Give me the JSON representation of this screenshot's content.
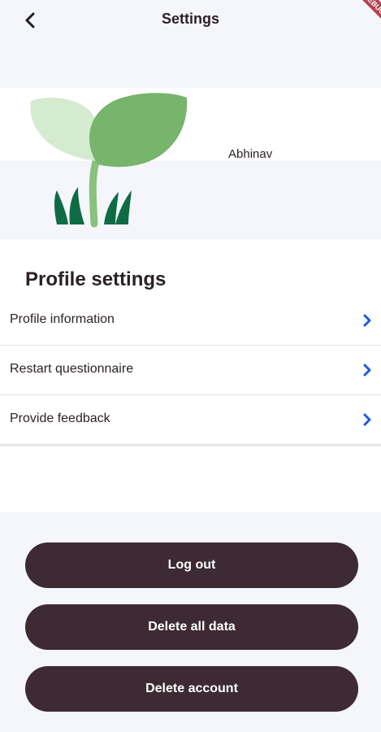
{
  "appbar": {
    "title": "Settings",
    "back_icon": "chevron-left-icon",
    "debug_banner": "DEBUG"
  },
  "profile": {
    "name": "Abhinav",
    "avatar_icon": "sprout-icon"
  },
  "settings": {
    "title": "Profile settings",
    "items": [
      {
        "label": "Profile information",
        "icon": "chevron-right-icon"
      },
      {
        "label": "Restart questionnaire",
        "icon": "chevron-right-icon"
      },
      {
        "label": "Provide feedback",
        "icon": "chevron-right-icon"
      }
    ]
  },
  "actions": {
    "logout": "Log out",
    "delete_data": "Delete all data",
    "delete_account": "Delete account"
  },
  "colors": {
    "background": "#f4f6fb",
    "button": "#3d2a33",
    "chevron": "#1a5be3",
    "leaf_light": "#d4ebd0",
    "leaf_dark": "#77b46c",
    "grass": "#0f6b43"
  }
}
